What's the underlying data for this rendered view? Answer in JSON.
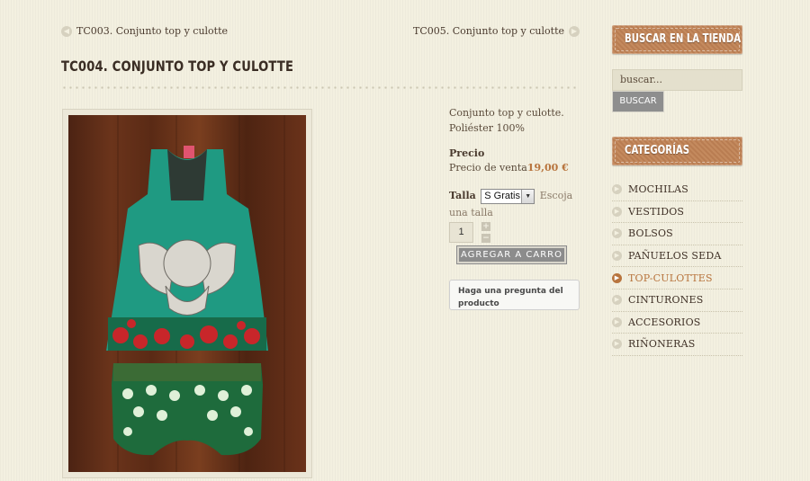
{
  "nav": {
    "prev_label": "TC003. Conjunto top y culotte",
    "next_label": "TC005. Conjunto top y culotte"
  },
  "product": {
    "title": "TC004. CONJUNTO TOP Y CULOTTE",
    "description_line1": "Conjunto top y culotte.",
    "description_line2": "Poliéster 100%",
    "price_heading": "Precio",
    "price_prefix": "Precio de venta",
    "price_value": "19,00 €",
    "size_label": "Talla",
    "size_selected": "S Gratis",
    "size_hint": "Escoja una talla",
    "quantity": "1",
    "add_to_cart": "AGREGAR A CARRO",
    "ask_question": "Haga una pregunta del producto"
  },
  "sidebar": {
    "search_heading": "BUSCAR EN LA TIENDA",
    "search_placeholder": "buscar...",
    "search_button": "BUSCAR",
    "categories_heading": "CATEGORÍAS",
    "categories": [
      {
        "label": "MOCHILAS"
      },
      {
        "label": "VESTIDOS"
      },
      {
        "label": "BOLSOS"
      },
      {
        "label": "PAÑUELOS SEDA"
      },
      {
        "label": "TOP-CULOTTES"
      },
      {
        "label": "CINTURONES"
      },
      {
        "label": "ACCESORIOS"
      },
      {
        "label": "RIÑONERAS"
      }
    ],
    "active_category": "TOP-CULOTTES"
  },
  "colors": {
    "accent": "#b8743d",
    "background": "#f3f0e0",
    "ribbon": "#c48a5e",
    "button_gray": "#8c8c8c"
  }
}
